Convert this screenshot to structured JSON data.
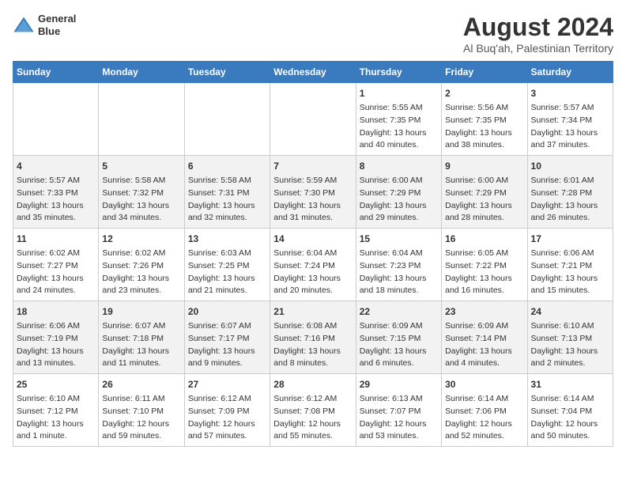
{
  "header": {
    "logo_line1": "General",
    "logo_line2": "Blue",
    "main_title": "August 2024",
    "subtitle": "Al Buq'ah, Palestinian Territory"
  },
  "days_of_week": [
    "Sunday",
    "Monday",
    "Tuesday",
    "Wednesday",
    "Thursday",
    "Friday",
    "Saturday"
  ],
  "weeks": [
    [
      {
        "day": "",
        "info": ""
      },
      {
        "day": "",
        "info": ""
      },
      {
        "day": "",
        "info": ""
      },
      {
        "day": "",
        "info": ""
      },
      {
        "day": "1",
        "info": "Sunrise: 5:55 AM\nSunset: 7:35 PM\nDaylight: 13 hours\nand 40 minutes."
      },
      {
        "day": "2",
        "info": "Sunrise: 5:56 AM\nSunset: 7:35 PM\nDaylight: 13 hours\nand 38 minutes."
      },
      {
        "day": "3",
        "info": "Sunrise: 5:57 AM\nSunset: 7:34 PM\nDaylight: 13 hours\nand 37 minutes."
      }
    ],
    [
      {
        "day": "4",
        "info": "Sunrise: 5:57 AM\nSunset: 7:33 PM\nDaylight: 13 hours\nand 35 minutes."
      },
      {
        "day": "5",
        "info": "Sunrise: 5:58 AM\nSunset: 7:32 PM\nDaylight: 13 hours\nand 34 minutes."
      },
      {
        "day": "6",
        "info": "Sunrise: 5:58 AM\nSunset: 7:31 PM\nDaylight: 13 hours\nand 32 minutes."
      },
      {
        "day": "7",
        "info": "Sunrise: 5:59 AM\nSunset: 7:30 PM\nDaylight: 13 hours\nand 31 minutes."
      },
      {
        "day": "8",
        "info": "Sunrise: 6:00 AM\nSunset: 7:29 PM\nDaylight: 13 hours\nand 29 minutes."
      },
      {
        "day": "9",
        "info": "Sunrise: 6:00 AM\nSunset: 7:29 PM\nDaylight: 13 hours\nand 28 minutes."
      },
      {
        "day": "10",
        "info": "Sunrise: 6:01 AM\nSunset: 7:28 PM\nDaylight: 13 hours\nand 26 minutes."
      }
    ],
    [
      {
        "day": "11",
        "info": "Sunrise: 6:02 AM\nSunset: 7:27 PM\nDaylight: 13 hours\nand 24 minutes."
      },
      {
        "day": "12",
        "info": "Sunrise: 6:02 AM\nSunset: 7:26 PM\nDaylight: 13 hours\nand 23 minutes."
      },
      {
        "day": "13",
        "info": "Sunrise: 6:03 AM\nSunset: 7:25 PM\nDaylight: 13 hours\nand 21 minutes."
      },
      {
        "day": "14",
        "info": "Sunrise: 6:04 AM\nSunset: 7:24 PM\nDaylight: 13 hours\nand 20 minutes."
      },
      {
        "day": "15",
        "info": "Sunrise: 6:04 AM\nSunset: 7:23 PM\nDaylight: 13 hours\nand 18 minutes."
      },
      {
        "day": "16",
        "info": "Sunrise: 6:05 AM\nSunset: 7:22 PM\nDaylight: 13 hours\nand 16 minutes."
      },
      {
        "day": "17",
        "info": "Sunrise: 6:06 AM\nSunset: 7:21 PM\nDaylight: 13 hours\nand 15 minutes."
      }
    ],
    [
      {
        "day": "18",
        "info": "Sunrise: 6:06 AM\nSunset: 7:19 PM\nDaylight: 13 hours\nand 13 minutes."
      },
      {
        "day": "19",
        "info": "Sunrise: 6:07 AM\nSunset: 7:18 PM\nDaylight: 13 hours\nand 11 minutes."
      },
      {
        "day": "20",
        "info": "Sunrise: 6:07 AM\nSunset: 7:17 PM\nDaylight: 13 hours\nand 9 minutes."
      },
      {
        "day": "21",
        "info": "Sunrise: 6:08 AM\nSunset: 7:16 PM\nDaylight: 13 hours\nand 8 minutes."
      },
      {
        "day": "22",
        "info": "Sunrise: 6:09 AM\nSunset: 7:15 PM\nDaylight: 13 hours\nand 6 minutes."
      },
      {
        "day": "23",
        "info": "Sunrise: 6:09 AM\nSunset: 7:14 PM\nDaylight: 13 hours\nand 4 minutes."
      },
      {
        "day": "24",
        "info": "Sunrise: 6:10 AM\nSunset: 7:13 PM\nDaylight: 13 hours\nand 2 minutes."
      }
    ],
    [
      {
        "day": "25",
        "info": "Sunrise: 6:10 AM\nSunset: 7:12 PM\nDaylight: 13 hours\nand 1 minute."
      },
      {
        "day": "26",
        "info": "Sunrise: 6:11 AM\nSunset: 7:10 PM\nDaylight: 12 hours\nand 59 minutes."
      },
      {
        "day": "27",
        "info": "Sunrise: 6:12 AM\nSunset: 7:09 PM\nDaylight: 12 hours\nand 57 minutes."
      },
      {
        "day": "28",
        "info": "Sunrise: 6:12 AM\nSunset: 7:08 PM\nDaylight: 12 hours\nand 55 minutes."
      },
      {
        "day": "29",
        "info": "Sunrise: 6:13 AM\nSunset: 7:07 PM\nDaylight: 12 hours\nand 53 minutes."
      },
      {
        "day": "30",
        "info": "Sunrise: 6:14 AM\nSunset: 7:06 PM\nDaylight: 12 hours\nand 52 minutes."
      },
      {
        "day": "31",
        "info": "Sunrise: 6:14 AM\nSunset: 7:04 PM\nDaylight: 12 hours\nand 50 minutes."
      }
    ]
  ]
}
